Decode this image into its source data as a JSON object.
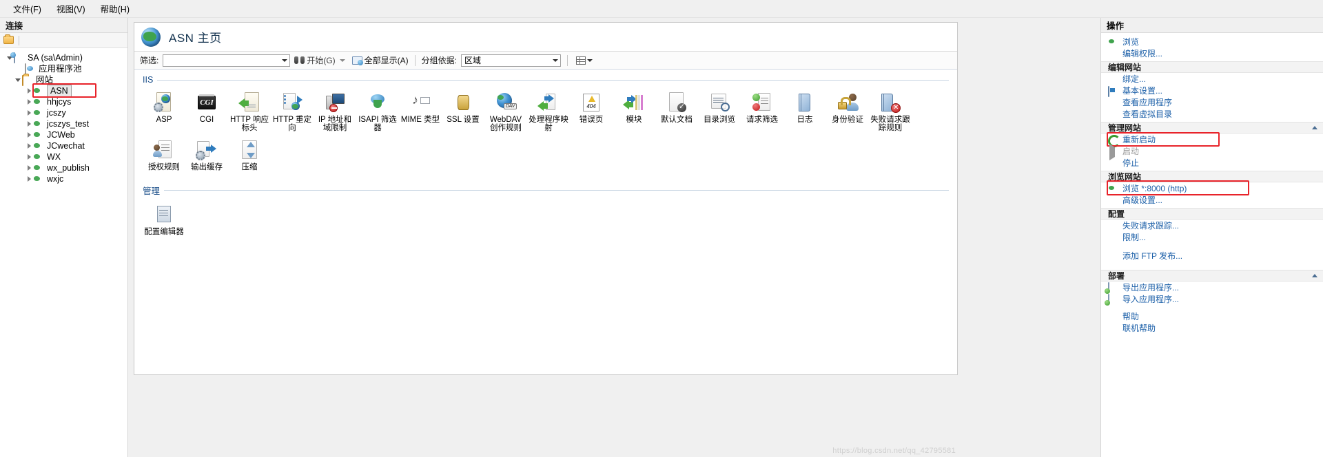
{
  "window": {
    "menu": [
      {
        "label": "文件(F)",
        "name": "menu-file"
      },
      {
        "label": "视图(V)",
        "name": "menu-view"
      },
      {
        "label": "帮助(H)",
        "name": "menu-help"
      }
    ]
  },
  "connections": {
    "title": "连接",
    "toolbar_icons": [
      "connect-to-server-icon"
    ],
    "tree": [
      {
        "label": "SA (sa\\Admin)",
        "icon": "server-icon",
        "expander": "open",
        "indent": 0,
        "selected": false
      },
      {
        "label": "应用程序池",
        "icon": "app-pool-icon",
        "expander": "none",
        "indent": 1,
        "selected": false
      },
      {
        "label": "网站",
        "icon": "folder-sites-icon",
        "expander": "open",
        "indent": 1,
        "selected": false
      },
      {
        "label": "ASN",
        "icon": "site-globe-icon",
        "expander": "closed",
        "indent": 2,
        "selected": true
      },
      {
        "label": "hhjcys",
        "icon": "site-globe-icon",
        "expander": "closed",
        "indent": 2,
        "selected": false
      },
      {
        "label": "jcszy",
        "icon": "site-globe-icon",
        "expander": "closed",
        "indent": 2,
        "selected": false
      },
      {
        "label": "jcszys_test",
        "icon": "site-globe-icon",
        "expander": "closed",
        "indent": 2,
        "selected": false
      },
      {
        "label": "JCWeb",
        "icon": "site-globe-icon",
        "expander": "closed",
        "indent": 2,
        "selected": false
      },
      {
        "label": "JCwechat",
        "icon": "site-globe-icon",
        "expander": "closed",
        "indent": 2,
        "selected": false
      },
      {
        "label": "WX",
        "icon": "site-globe-icon",
        "expander": "closed",
        "indent": 2,
        "selected": false
      },
      {
        "label": "wx_publish",
        "icon": "site-globe-icon",
        "expander": "closed",
        "indent": 2,
        "selected": false
      },
      {
        "label": "wxjc",
        "icon": "site-globe-icon",
        "expander": "closed",
        "indent": 2,
        "selected": false
      }
    ]
  },
  "main": {
    "page_title": "ASN 主页",
    "page_icon": "site-globe-icon",
    "filter_bar": {
      "filter_label": "筛选:",
      "filter_value": "",
      "go_label": "开始(G)",
      "show_all_label": "全部显示(A)",
      "group_by_label": "分组依据:",
      "group_by_value": "区域"
    },
    "sections": [
      {
        "name": "IIS",
        "items": [
          {
            "label": "ASP",
            "icon": "asp-icon"
          },
          {
            "label": "CGI",
            "icon": "cgi-icon"
          },
          {
            "label": "HTTP 响应标头",
            "icon": "http-response-headers-icon"
          },
          {
            "label": "HTTP 重定向",
            "icon": "http-redirect-icon"
          },
          {
            "label": "IP 地址和域限制",
            "icon": "ip-address-domain-restrictions-icon"
          },
          {
            "label": "ISAPI 筛选器",
            "icon": "isapi-filters-icon"
          },
          {
            "label": "MIME 类型",
            "icon": "mime-types-icon"
          },
          {
            "label": "SSL 设置",
            "icon": "ssl-settings-icon"
          },
          {
            "label": "WebDAV 创作规则",
            "icon": "webdav-authoring-rules-icon"
          },
          {
            "label": "处理程序映射",
            "icon": "handler-mappings-icon"
          },
          {
            "label": "错误页",
            "icon": "error-pages-icon"
          },
          {
            "label": "模块",
            "icon": "modules-icon"
          },
          {
            "label": "默认文档",
            "icon": "default-document-icon"
          },
          {
            "label": "目录浏览",
            "icon": "directory-browsing-icon"
          },
          {
            "label": "请求筛选",
            "icon": "request-filtering-icon"
          },
          {
            "label": "日志",
            "icon": "logging-icon"
          },
          {
            "label": "身份验证",
            "icon": "authentication-icon"
          },
          {
            "label": "失败请求跟踪规则",
            "icon": "failed-request-tracing-rules-icon"
          },
          {
            "label": "授权规则",
            "icon": "authorization-rules-icon"
          },
          {
            "label": "输出缓存",
            "icon": "output-caching-icon"
          },
          {
            "label": "压缩",
            "icon": "compression-icon"
          }
        ]
      },
      {
        "name": "管理",
        "items": [
          {
            "label": "配置编辑器",
            "icon": "configuration-editor-icon"
          }
        ]
      }
    ]
  },
  "actions": {
    "title": "操作",
    "groups": [
      {
        "heading": null,
        "items": [
          {
            "label": "浏览",
            "icon": "globe-icon",
            "style": "icon",
            "state": "enabled"
          },
          {
            "label": "编辑权限...",
            "icon": "none",
            "style": "sub",
            "state": "enabled"
          }
        ]
      },
      {
        "heading": "编辑网站",
        "items": [
          {
            "label": "绑定...",
            "icon": "none",
            "style": "sub",
            "state": "enabled"
          },
          {
            "label": "基本设置...",
            "icon": "window-icon",
            "style": "icon",
            "state": "enabled"
          },
          {
            "label": "查看应用程序",
            "icon": "none",
            "style": "sub",
            "state": "enabled"
          },
          {
            "label": "查看虚拟目录",
            "icon": "none",
            "style": "sub",
            "state": "enabled"
          }
        ]
      },
      {
        "heading": "管理网站",
        "collapsible": true,
        "items": [
          {
            "label": "重新启动",
            "icon": "restart-icon",
            "style": "icon",
            "state": "enabled",
            "highlight": true
          },
          {
            "label": "启动",
            "icon": "play-icon",
            "style": "icon",
            "state": "disabled"
          },
          {
            "label": "停止",
            "icon": "stop-icon",
            "style": "icon",
            "state": "enabled"
          }
        ]
      },
      {
        "heading": "浏览网站",
        "items": [
          {
            "label": "浏览 *:8000 (http)",
            "icon": "globe-icon",
            "style": "icon",
            "state": "enabled",
            "highlight": true
          },
          {
            "label": "高级设置...",
            "icon": "none",
            "style": "sub",
            "state": "enabled"
          }
        ]
      },
      {
        "heading": "配置",
        "items": [
          {
            "label": "失败请求跟踪...",
            "icon": "none",
            "style": "sub",
            "state": "enabled"
          },
          {
            "label": "限制...",
            "icon": "none",
            "style": "sub",
            "state": "enabled"
          },
          {
            "label": "添加 FTP 发布...",
            "icon": "none",
            "style": "sub",
            "state": "enabled"
          }
        ]
      },
      {
        "heading": "部署",
        "collapsible": true,
        "items": [
          {
            "label": "导出应用程序...",
            "icon": "export-icon",
            "style": "icon",
            "state": "enabled"
          },
          {
            "label": "导入应用程序...",
            "icon": "export-icon",
            "style": "icon",
            "state": "enabled"
          },
          {
            "label": "帮助",
            "icon": "help-icon",
            "style": "icon",
            "state": "enabled"
          },
          {
            "label": "联机帮助",
            "icon": "none",
            "style": "sub",
            "state": "enabled"
          }
        ]
      }
    ]
  },
  "watermark": "https://blog.csdn.net/qq_42795581",
  "colors": {
    "highlight_red": "#e8232a",
    "link_blue": "#1b5fa8",
    "section_blue": "#1b4f8a",
    "title_navy": "#14334f"
  }
}
